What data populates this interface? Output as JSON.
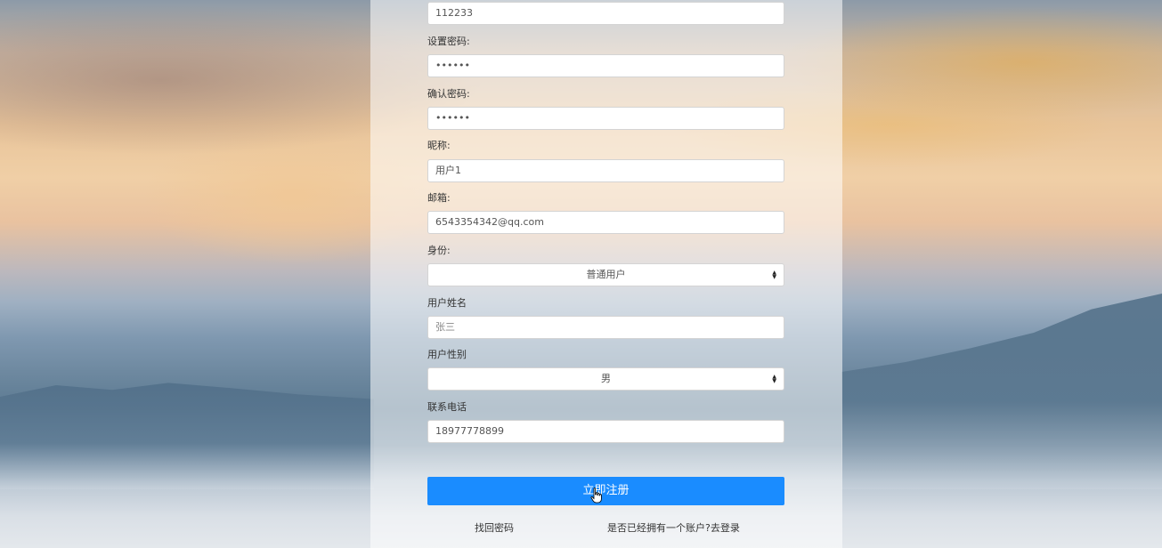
{
  "form": {
    "username_value": "112233",
    "password_label": "设置密码:",
    "password_value": "••••••",
    "confirm_label": "确认密码:",
    "confirm_value": "••••••",
    "nickname_label": "昵称:",
    "nickname_value": "用户1",
    "email_label": "邮箱:",
    "email_value": "6543354342@qq.com",
    "identity_label": "身份:",
    "identity_value": "普通用户",
    "realname_label": "用户姓名",
    "realname_placeholder": "张三",
    "gender_label": "用户性别",
    "gender_value": "男",
    "phone_label": "联系电话",
    "phone_value": "18977778899",
    "submit_label": "立即注册",
    "forgot_link": "找回密码",
    "login_link": "是否已经拥有一个账户?去登录"
  },
  "icons": {
    "select_arrow": "updown-arrows-icon",
    "cursor": "hand-pointer-icon"
  },
  "colors": {
    "accent": "#1a8cff"
  }
}
